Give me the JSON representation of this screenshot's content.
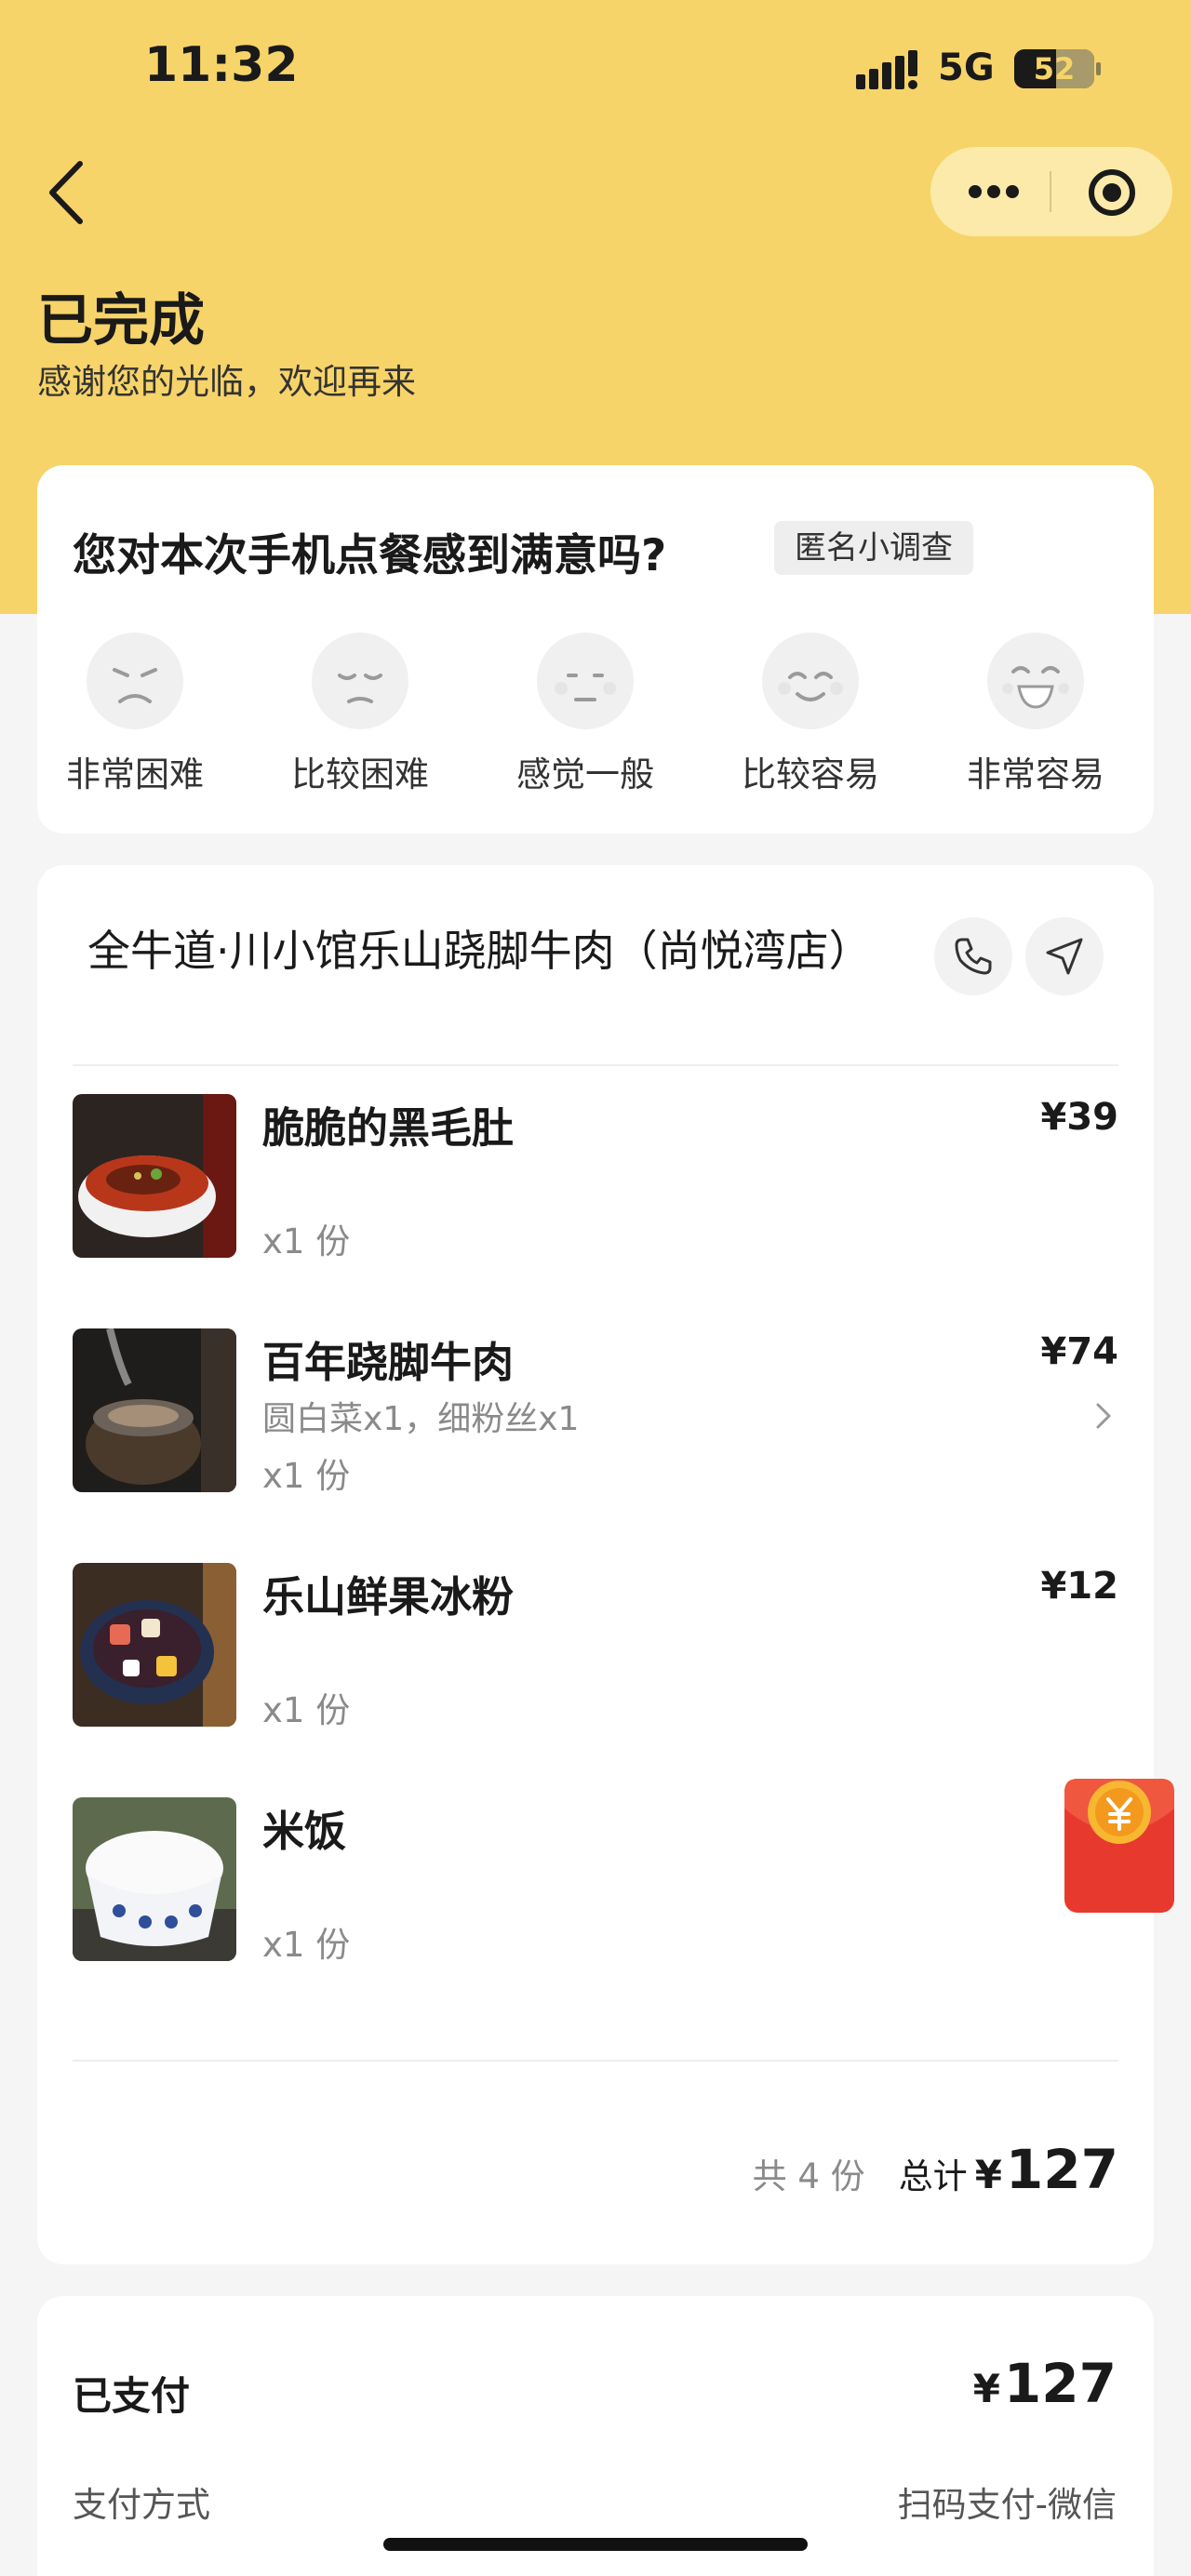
{
  "status_bar": {
    "time": "11:32",
    "network": "5G",
    "battery": "52",
    "battery_level": 0.52
  },
  "header": {
    "title": "已完成",
    "subtitle": "感谢您的光临，欢迎再来",
    "menu_icon": "more-dots-icon",
    "close_icon": "target-circle-icon"
  },
  "survey": {
    "question": "您对本次手机点餐感到满意吗?",
    "badge": "匿名小调查",
    "options": [
      {
        "label": "非常困难",
        "icon": "very-angry-face-icon"
      },
      {
        "label": "比较困难",
        "icon": "sad-face-icon"
      },
      {
        "label": "感觉一般",
        "icon": "neutral-face-icon"
      },
      {
        "label": "比较容易",
        "icon": "smile-face-icon"
      },
      {
        "label": "非常容易",
        "icon": "laugh-face-icon"
      }
    ]
  },
  "order": {
    "store_name": "全牛道·川小馆乐山跷脚牛肉（尚悦湾店）",
    "items": [
      {
        "name": "脆脆的黑毛肚",
        "spec": "",
        "qty": "x1 份",
        "price": "¥39"
      },
      {
        "name": "百年跷脚牛肉",
        "spec": "圆白菜x1，细粉丝x1",
        "qty": "x1 份",
        "price": "¥74"
      },
      {
        "name": "乐山鲜果冰粉",
        "spec": "",
        "qty": "x1 份",
        "price": "¥12"
      },
      {
        "name": "米饭",
        "spec": "",
        "qty": "x1 份",
        "price": ""
      }
    ],
    "count_text": "共 4 份",
    "total_label": "总计",
    "currency": "¥",
    "total": "127"
  },
  "payment": {
    "label": "已支付",
    "currency": "¥",
    "amount": "127",
    "method_label": "支付方式",
    "method_value": "扫码支付-微信"
  },
  "colors": {
    "header_yellow": "#f7d469",
    "red_packet": "#e8392e"
  }
}
